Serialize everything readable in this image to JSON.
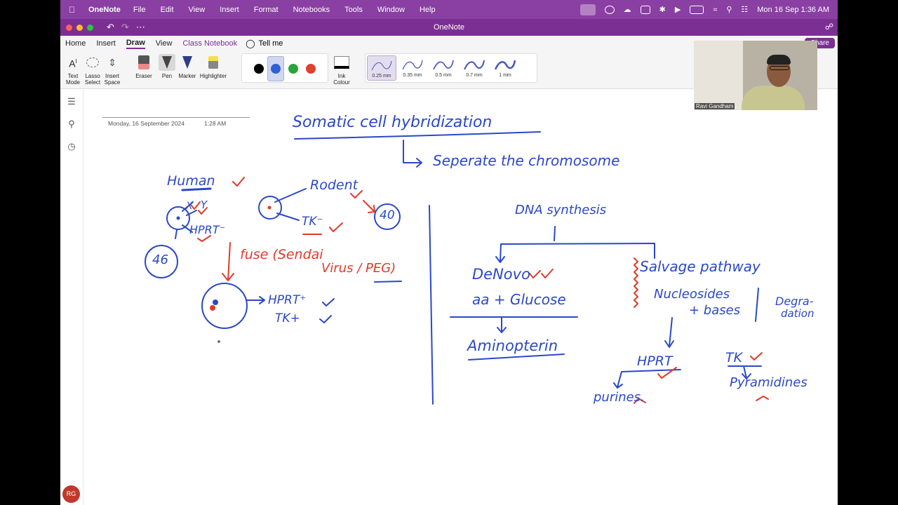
{
  "menubar": {
    "app_name": "OneNote",
    "items": [
      "File",
      "Edit",
      "View",
      "Insert",
      "Format",
      "Notebooks",
      "Tools",
      "Window",
      "Help"
    ],
    "clock": "Mon 16 Sep  1:36 AM"
  },
  "window": {
    "title": "OneNote"
  },
  "ribbon": {
    "tabs": [
      "Home",
      "Insert",
      "Draw",
      "View",
      "Class Notebook"
    ],
    "active_tab": "Draw",
    "tell_me": "Tell me",
    "share": "Share",
    "tools": {
      "text_mode": "Text Mode",
      "lasso_select": "Lasso Select",
      "insert_space": "Insert Space",
      "eraser": "Eraser",
      "pen": "Pen",
      "marker": "Marker",
      "highlighter": "Highlighter",
      "ink_colour": "Ink Colour"
    },
    "pen_colors": [
      "#000000",
      "#2f5fd8",
      "#2aa33a",
      "#e0402c"
    ],
    "selected_pen_color": "#2f5fd8",
    "thicknesses": [
      "0.25 mm",
      "0.35 mm",
      "0.5 mm",
      "0.7 mm",
      "1 mm"
    ],
    "selected_thickness": "0.25 mm"
  },
  "page": {
    "date": "Monday, 16 September 2024",
    "time": "1:28 AM"
  },
  "ink": {
    "title": "Somatic cell hybridization",
    "subtitle": "Seperate the chromosome",
    "human": "Human",
    "rodent": "Rodent",
    "x": "X",
    "y": "Y",
    "hprt_minus": "HPRT⁻",
    "tk_minus": "TK⁻",
    "n46": "46",
    "n40": "40",
    "fuse": "fuse (Sendai",
    "virus": "Virus / PEG)",
    "hprt_plus": "HPRT⁺",
    "tk_plus": "TK+",
    "dna": "DNA synthesis",
    "denovo": "DeNovo",
    "aa_glucose": "aa + Glucose",
    "aminopterin": "Aminopterin",
    "salvage": "Salvage pathway",
    "nucleosides": "Nucleosides",
    "bases": "+ bases",
    "degra": "Degra-",
    "dation": "dation",
    "hprt": "HPRT",
    "tk": "TK",
    "purines": "purines.",
    "pyrimidines": "Pyramidines"
  },
  "webcam": {
    "name": "Ravi Gandham"
  },
  "user": {
    "initials": "RG"
  }
}
